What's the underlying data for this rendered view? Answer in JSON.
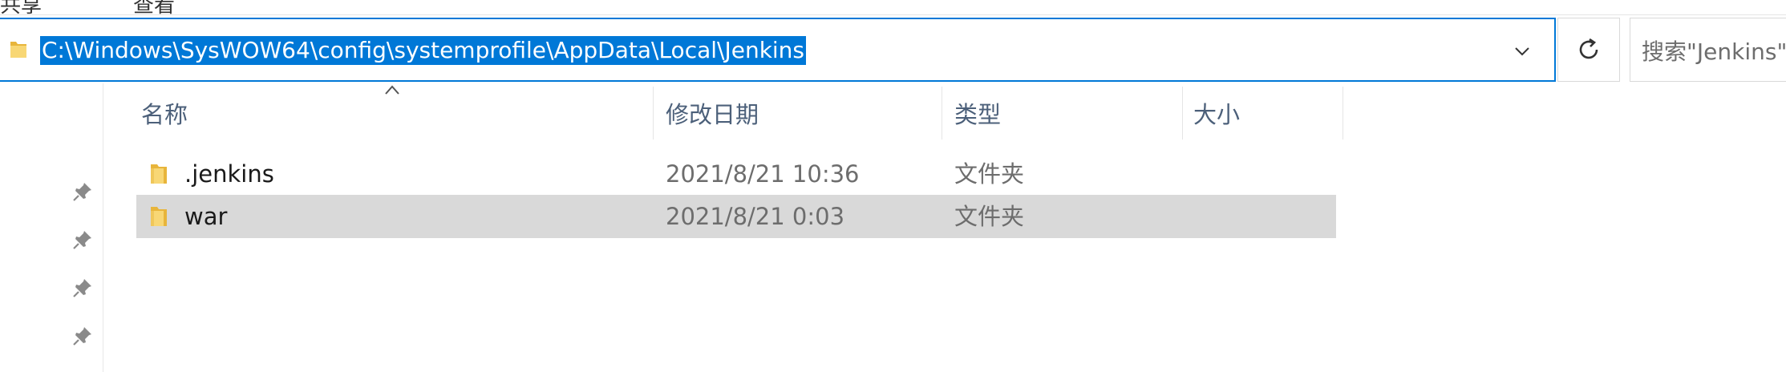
{
  "ribbon": {
    "partial_labels": [
      "共享",
      "查看"
    ]
  },
  "address_bar": {
    "path": "C:\\Windows\\SysWOW64\\config\\systemprofile\\AppData\\Local\\Jenkins",
    "dropdown_icon": "chevron-down-icon",
    "refresh_icon": "refresh-icon"
  },
  "search": {
    "placeholder": "搜索\"Jenkins\""
  },
  "columns": {
    "name": "名称",
    "date_modified": "修改日期",
    "type": "类型",
    "size": "大小",
    "sort_indicator": "caret-up-icon"
  },
  "files": [
    {
      "name": ".jenkins",
      "date_modified": "2021/8/21 10:36",
      "type": "文件夹",
      "size": "",
      "selected": false,
      "icon": "folder-icon"
    },
    {
      "name": "war",
      "date_modified": "2021/8/21 0:03",
      "type": "文件夹",
      "size": "",
      "selected": true,
      "icon": "folder-icon"
    }
  ],
  "nav_pins": [
    "pin-icon",
    "pin-icon",
    "pin-icon",
    "pin-icon"
  ],
  "colors": {
    "accent": "#0078d7",
    "selection": "#d9d9d9",
    "header_text": "#4c607a",
    "secondary_text": "#6d6d6d",
    "folder_yellow": "#f8d775"
  }
}
